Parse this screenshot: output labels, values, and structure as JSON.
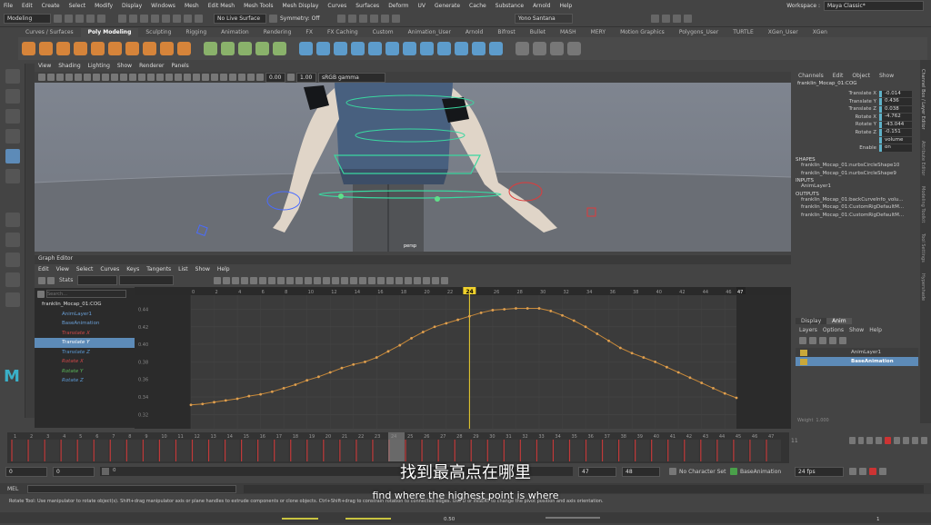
{
  "menubar": {
    "items": [
      "File",
      "Edit",
      "Create",
      "Select",
      "Modify",
      "Display",
      "Windows",
      "Mesh",
      "Edit Mesh",
      "Mesh Tools",
      "Mesh Display",
      "Curves",
      "Surfaces",
      "Deform",
      "UV",
      "Generate",
      "Cache",
      "Substance",
      "Arnold",
      "Help"
    ],
    "workspace_label": "Workspace :",
    "workspace_value": "Maya Classic*"
  },
  "statusline": {
    "mode": "Modeling",
    "live_surface": "No Live Surface",
    "symmetry": "Symmetry: Off",
    "user": "Yono Santana"
  },
  "shelf": {
    "tabs": [
      "Curves / Surfaces",
      "Poly Modeling",
      "Sculpting",
      "Rigging",
      "Animation",
      "Rendering",
      "FX",
      "FX Caching",
      "Custom",
      "Animation_User",
      "Arnold",
      "Bifrost",
      "Bullet",
      "MASH",
      "MERY",
      "Motion Graphics",
      "Polygons_User",
      "TURTLE",
      "XGen_User",
      "XGen"
    ],
    "active_tab": "Poly Modeling"
  },
  "viewport": {
    "menu": [
      "View",
      "Shading",
      "Lighting",
      "Show",
      "Renderer",
      "Panels"
    ],
    "field1": "0.00",
    "field2": "1.00",
    "color_space": "sRGB gamma",
    "camera_label": "persp"
  },
  "graph_editor": {
    "title": "Graph Editor",
    "menu": [
      "Edit",
      "View",
      "Select",
      "Curves",
      "Keys",
      "Tangents",
      "List",
      "Show",
      "Help"
    ],
    "stats_label": "Stats",
    "search_placeholder": "Search...",
    "outliner": {
      "root": "franklin_Mocap_01:COG",
      "items": [
        {
          "label": "AnimLayer1",
          "color": "#6a9fd6"
        },
        {
          "label": "BaseAnimation",
          "color": "#6a9fd6"
        },
        {
          "label": "Translate X",
          "color": "#d04848"
        },
        {
          "label": "Translate Y",
          "color": "#ffffff",
          "selected": true
        },
        {
          "label": "Translate Z",
          "color": "#5b9ad5"
        },
        {
          "label": "Rotate X",
          "color": "#d04848"
        },
        {
          "label": "Rotate Y",
          "color": "#5ab85a"
        },
        {
          "label": "Rotate Z",
          "color": "#5b9ad5"
        }
      ]
    },
    "ruler_start": "0",
    "ruler_end": "47",
    "current_frame": "24",
    "y_ticks": [
      "0.44",
      "0.42",
      "0.40",
      "0.38",
      "0.36",
      "0.34",
      "0.32"
    ],
    "frame_ticks": [
      "0",
      "2",
      "4",
      "6",
      "8",
      "10",
      "12",
      "14",
      "16",
      "18",
      "20",
      "22",
      "24",
      "26",
      "28",
      "30",
      "32",
      "34",
      "36",
      "38",
      "40",
      "42",
      "44",
      "46"
    ]
  },
  "chart_data": {
    "type": "line",
    "title": "",
    "xlabel": "",
    "ylabel": "",
    "xlim": [
      0,
      47
    ],
    "ylim": [
      0.31,
      0.455
    ],
    "series": [
      {
        "name": "Translate Y",
        "x": [
          0,
          1,
          2,
          3,
          4,
          5,
          6,
          7,
          8,
          9,
          10,
          11,
          12,
          13,
          14,
          15,
          16,
          17,
          18,
          19,
          20,
          21,
          22,
          23,
          24,
          25,
          26,
          27,
          28,
          29,
          30,
          31,
          32,
          33,
          34,
          35,
          36,
          37,
          38,
          39,
          40,
          41,
          42,
          43,
          44,
          45,
          46,
          47
        ],
        "values": [
          0.331,
          0.332,
          0.334,
          0.336,
          0.338,
          0.341,
          0.343,
          0.346,
          0.35,
          0.354,
          0.359,
          0.363,
          0.368,
          0.373,
          0.377,
          0.38,
          0.385,
          0.392,
          0.399,
          0.407,
          0.414,
          0.42,
          0.424,
          0.428,
          0.432,
          0.436,
          0.439,
          0.44,
          0.441,
          0.441,
          0.441,
          0.438,
          0.433,
          0.427,
          0.42,
          0.412,
          0.404,
          0.396,
          0.39,
          0.385,
          0.38,
          0.374,
          0.368,
          0.362,
          0.356,
          0.35,
          0.344,
          0.339
        ]
      }
    ]
  },
  "timeline": {
    "frames": [
      "1",
      "2",
      "3",
      "4",
      "5",
      "6",
      "7",
      "8",
      "9",
      "10",
      "11",
      "12",
      "13",
      "14",
      "15",
      "16",
      "17",
      "18",
      "19",
      "20",
      "21",
      "22",
      "23",
      "24",
      "25",
      "26",
      "27",
      "28",
      "29",
      "30",
      "31",
      "32",
      "33",
      "34",
      "35",
      "36",
      "37",
      "38",
      "39",
      "40",
      "41",
      "42",
      "43",
      "44",
      "45",
      "46",
      "47"
    ],
    "current": "24",
    "end_label": "11"
  },
  "range": {
    "start1": "0",
    "start2": "0",
    "slider_start": "0",
    "end1": "47",
    "end2": "48",
    "character_set": "No Character Set",
    "layer": "BaseAnimation",
    "fps": "24 fps"
  },
  "cmd": {
    "lang": "MEL"
  },
  "helpline": "Rotate Tool: Use manipulator to rotate object(s). Shift+drag manipulator axis or plane handles to extrude components or clone objects. Ctrl+Shift+drag to constrain rotation to connected edges. Use D or INSERT to change the pivot position and axis orientation.",
  "subtitles": {
    "chinese": "找到最高点在哪里",
    "english": "find where the highest point is where"
  },
  "channelbox": {
    "tabs": [
      "Channels",
      "Edit",
      "Object",
      "Show"
    ],
    "object": "franklin_Mocap_01:COG",
    "channels": [
      {
        "label": "Translate X",
        "value": "-0.014"
      },
      {
        "label": "Translate Y",
        "value": "0.436"
      },
      {
        "label": "Translate Z",
        "value": "0.038"
      },
      {
        "label": "Rotate X",
        "value": "-4.762"
      },
      {
        "label": "Rotate Y",
        "value": "-43.044"
      },
      {
        "label": "Rotate Z",
        "value": "-0.151"
      },
      {
        "label": "",
        "value": "volume"
      },
      {
        "label": "Enable",
        "value": "on"
      }
    ],
    "shapes_heading": "SHAPES",
    "shapes": [
      "franklin_Mocap_01:nurbsCircleShape10",
      "franklin_Mocap_01:nurbsCircleShape9"
    ],
    "inputs_heading": "INPUTS",
    "inputs": [
      "AnimLayer1"
    ],
    "outputs_heading": "OUTPUTS",
    "outputs": [
      "franklin_Mocap_01:backCurveInfo_volu...",
      "franklin_Mocap_01:CustomRigDefaultM...",
      "franklin_Mocap_01:CustomRigDefaultM..."
    ]
  },
  "anim_layers": {
    "tabs": [
      "Display",
      "Anim"
    ],
    "menu": [
      "Layers",
      "Options",
      "Show",
      "Help"
    ],
    "layers": [
      "AnimLayer1",
      "BaseAnimation"
    ],
    "weight_label": "Weight",
    "weight_value": "1.000"
  },
  "right_strip": [
    "Channel Box / Layer Editor",
    "Attribute Editor",
    "Modeling Toolkit",
    "Tool Settings",
    "Hypershade"
  ],
  "colors": {
    "curve": "#c98a3a",
    "current_frame": "#f0d12c",
    "accent": "#5d8bb8"
  }
}
